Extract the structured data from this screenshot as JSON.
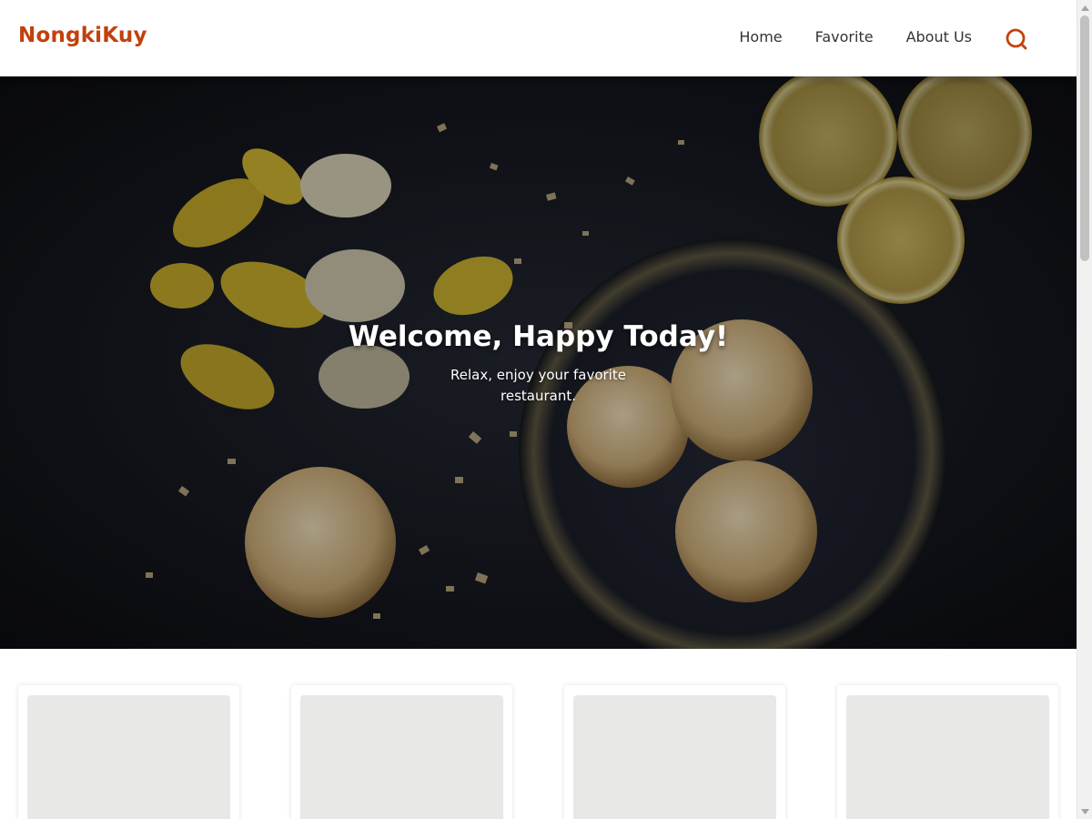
{
  "header": {
    "brand": "NongkiKuy",
    "nav": [
      {
        "label": "Home"
      },
      {
        "label": "Favorite"
      },
      {
        "label": "About Us"
      }
    ],
    "search_icon": "search-icon"
  },
  "hero": {
    "title": "Welcome, Happy Today!",
    "subtitle": "Relax, enjoy your favorite restaurant."
  },
  "cards": [
    {
      "image": "placeholder"
    },
    {
      "image": "placeholder"
    },
    {
      "image": "placeholder"
    },
    {
      "image": "placeholder"
    }
  ],
  "colors": {
    "brand": "#c2410c",
    "nav_text": "#333333",
    "hero_bg": "#14161c",
    "card_placeholder": "#e8e8e6"
  }
}
